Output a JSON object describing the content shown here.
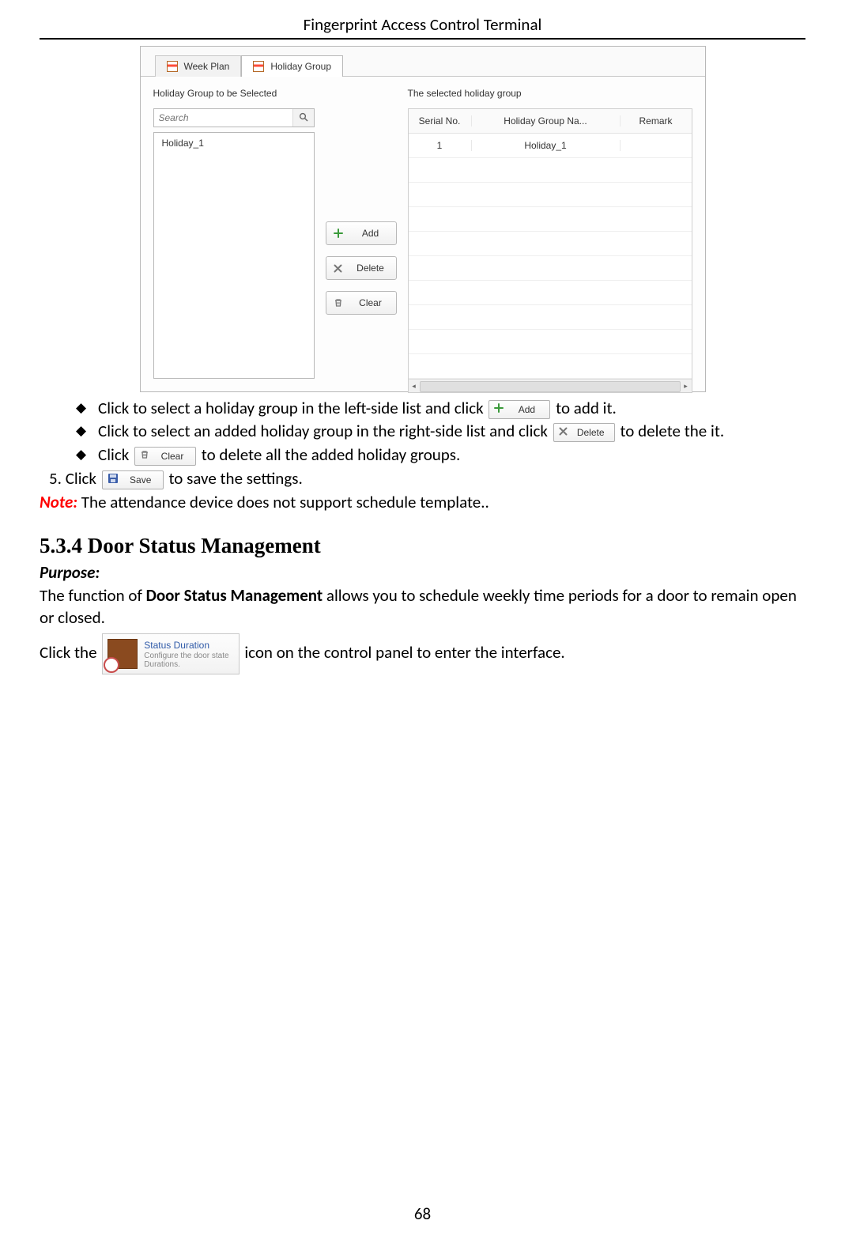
{
  "header": {
    "title": "Fingerprint Access Control Terminal"
  },
  "ui": {
    "tabs": {
      "week_plan": "Week Plan",
      "holiday_group": "Holiday Group"
    },
    "left": {
      "label": "Holiday Group to be Selected",
      "search_placeholder": "Search",
      "items": [
        "Holiday_1"
      ]
    },
    "mid": {
      "add": "Add",
      "delete": "Delete",
      "clear": "Clear"
    },
    "right": {
      "label": "The selected holiday group",
      "cols": {
        "c1": "Serial No.",
        "c2": "Holiday Group Na...",
        "c3": "Remark"
      },
      "rows": [
        {
          "serial": "1",
          "name": "Holiday_1",
          "remark": ""
        }
      ]
    }
  },
  "bullets": {
    "b1a": "Click to select a holiday group in the left-side list and click",
    "b1b": " to add it.",
    "b2a": "Click to select an added holiday group in the right-side list and click",
    "b2b": " to delete the it.",
    "b3a": "Click",
    "b3b": " to delete all the added holiday groups."
  },
  "inline_buttons": {
    "add": "Add",
    "delete": "Delete",
    "clear": "Clear",
    "save": "Save"
  },
  "step5": {
    "prefix": "5.   Click",
    "suffix": " to save the settings."
  },
  "note": {
    "label": "Note:",
    "text": " The attendance device does not support schedule template.."
  },
  "section": {
    "heading": "5.3.4   Door Status Management",
    "purpose_label": "Purpose:",
    "purpose_text_a": "The function of ",
    "purpose_bold": "Door Status Management",
    "purpose_text_b": " allows you to schedule weekly time periods for a door to remain open or closed.",
    "click_the": "Click the ",
    "card_title": "Status Duration",
    "card_sub1": "Configure the door state",
    "card_sub2": "Durations.",
    "click_suffix": " icon on the control panel to enter the interface."
  },
  "pagenum": "68"
}
